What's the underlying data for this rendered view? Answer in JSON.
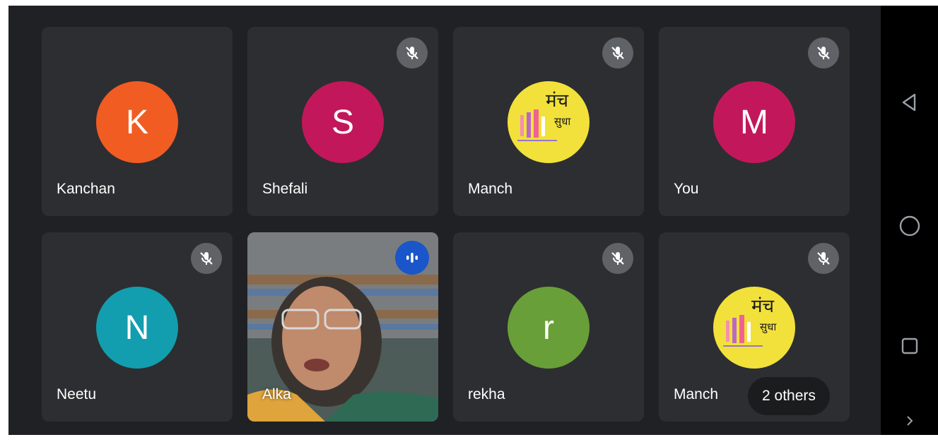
{
  "participants": [
    {
      "name": "Kanchan",
      "initial": "K",
      "color": "#f15c22",
      "muted": false
    },
    {
      "name": "Shefali",
      "initial": "S",
      "color": "#c2185b",
      "muted": true
    },
    {
      "name": "Manch",
      "logo_text_top": "मंच",
      "logo_text_bottom": "सुधा",
      "logo_color": "#f2e13a",
      "muted": true
    },
    {
      "name": "You",
      "initial": "M",
      "color": "#c2185b",
      "muted": true
    },
    {
      "name": "Neetu",
      "initial": "N",
      "color": "#129eaf",
      "muted": true
    },
    {
      "name": "Alka",
      "video": true,
      "speaking": true
    },
    {
      "name": "rekha",
      "initial": "r",
      "color": "#689f38",
      "muted": true
    },
    {
      "name": "Manch",
      "logo_text_top": "मंच",
      "logo_text_bottom": "सुधा",
      "logo_color": "#f2e13a",
      "muted": true
    }
  ],
  "others_label": "2 others",
  "icons": {
    "mute": "mic-off-icon",
    "speaking": "audio-level-icon",
    "back": "triangle-back-icon",
    "home": "circle-home-icon",
    "recents": "square-recents-icon",
    "more": "chevron-right-icon"
  }
}
